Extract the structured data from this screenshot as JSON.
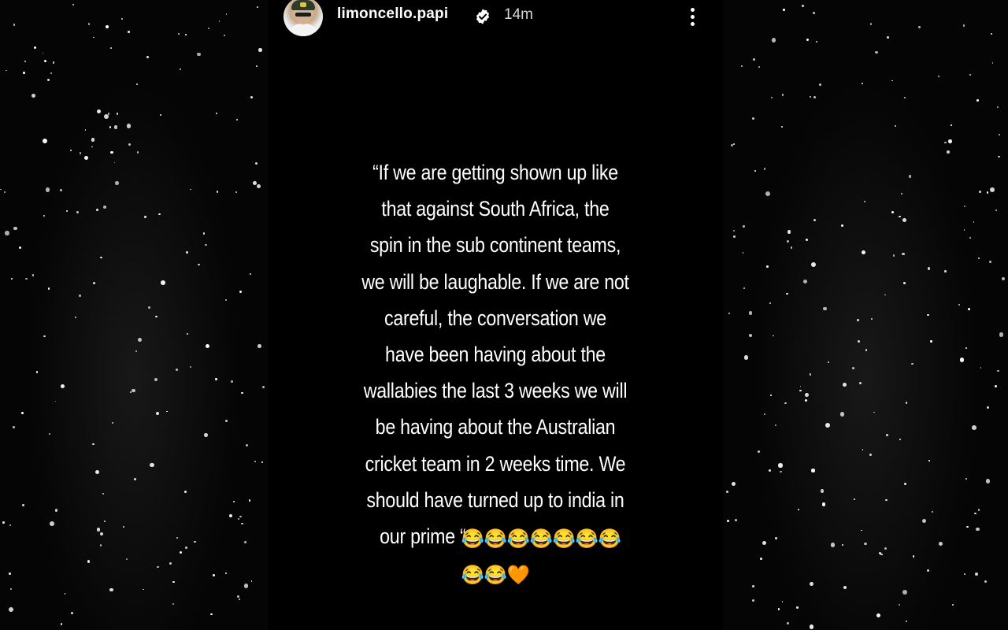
{
  "story": {
    "username": "limoncello.papi",
    "time_ago": "14m",
    "verified": true,
    "caption_lines": [
      "“If we are getting shown up like",
      "that against South Africa, the",
      "spin in the sub continent teams,",
      "we will be laughable. If we are not",
      "careful, the conversation we",
      "have been having about the",
      "wallabies the last 3 weeks we will",
      "be having about the Australian",
      "cricket team in 2 weeks time. We",
      "should have turned up to india in",
      "our prime “"
    ],
    "emoji_line_1": "😂😂😂😂😂😂😂",
    "emoji_line_2": "😂😂🧡"
  },
  "icons": {
    "verified": "verified-badge-icon",
    "more": "more-vertical-icon",
    "avatar": "profile-avatar"
  },
  "colors": {
    "background": "#000000",
    "text": "#ffffff",
    "timestamp": "#d6d6d6",
    "heart": "#f58220"
  }
}
